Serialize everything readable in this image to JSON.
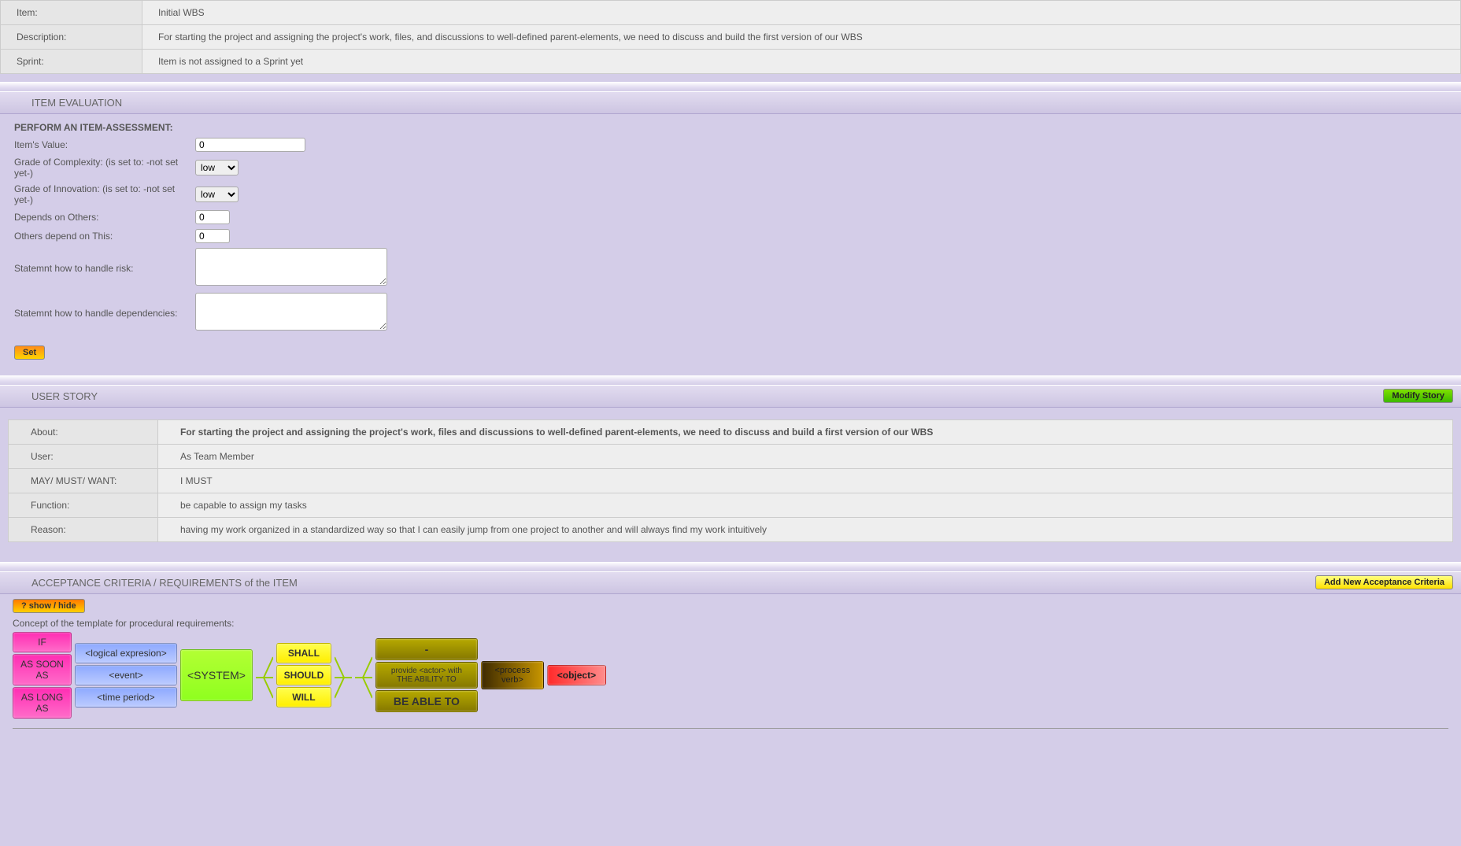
{
  "itemInfo": {
    "rows": [
      {
        "label": "Item:",
        "value": "Initial WBS"
      },
      {
        "label": "Description:",
        "value": "For starting the project and assigning the project's work, files, and discussions to well-defined parent-elements, we need to discuss and build the first version of our WBS"
      },
      {
        "label": "Sprint:",
        "value": "Item is not assigned to a Sprint yet"
      }
    ]
  },
  "evaluation": {
    "title": "ITEM EVALUATION",
    "heading": "PERFORM AN ITEM-ASSESSMENT:",
    "fields": {
      "value_label": "Item's Value:",
      "value_val": "0",
      "complexity_label": "Grade of Complexity: (is set to: -not set yet-)",
      "complexity_val": "low",
      "innovation_label": "Grade of Innovation: (is set to: -not set yet-)",
      "innovation_val": "low",
      "depends_on_label": "Depends on Others:",
      "depends_on_val": "0",
      "others_depend_label": "Others depend on This:",
      "others_depend_val": "0",
      "risk_label": "Statemnt how to handle risk:",
      "risk_val": "",
      "deps_label": "Statemnt how to handle dependencies:",
      "deps_val": "",
      "options": [
        "low"
      ]
    },
    "set_btn": "Set"
  },
  "userStory": {
    "title": "USER STORY",
    "modify_btn": "Modify Story",
    "rows": [
      {
        "label": "About:",
        "value": "For starting the project and assigning the project's work, files and discussions to well-defined parent-elements, we need to discuss and build a first version of our WBS",
        "bold": true
      },
      {
        "label": "User:",
        "value": "As Team Member"
      },
      {
        "label": "MAY/ MUST/ WANT:",
        "value": "I MUST"
      },
      {
        "label": "Function:",
        "value": "be capable to assign my tasks"
      },
      {
        "label": "Reason:",
        "value": "having my work organized in a standardized way so that I can easily jump from one project to another and will always find my work intuitively"
      }
    ]
  },
  "acceptance": {
    "title": "ACCEPTANCE CRITERIA / REQUIREMENTS of the ITEM",
    "add_btn": "Add New Acceptance Criteria",
    "toggle_btn": "? show / hide",
    "concept_label": "Concept of the template for procedural requirements:",
    "flow": {
      "conditions": [
        "IF",
        "AS SOON AS",
        "AS LONG AS"
      ],
      "slots": [
        "<logical expresion>",
        "<event>",
        "<time period>"
      ],
      "system": "<SYSTEM>",
      "modals": [
        "SHALL",
        "SHOULD",
        "WILL"
      ],
      "abilities": [
        "-",
        "provide <actor> with THE ABILITY TO",
        "BE ABLE TO"
      ],
      "process": "<process verb>",
      "object": "<object>"
    }
  }
}
